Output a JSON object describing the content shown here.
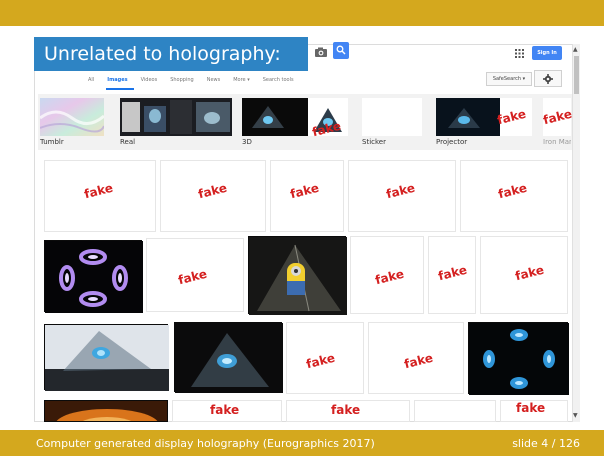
{
  "caption": "Unrelated to holography:",
  "footer": {
    "left": "Computer generated display holography (Eurographics 2017)",
    "right": "slide 4 / 126"
  },
  "header": {
    "sign_in": "Sign In"
  },
  "tabs": [
    "All",
    "Images",
    "Videos",
    "Shopping",
    "News",
    "More ▾",
    "Search tools"
  ],
  "active_tab": "Images",
  "safesearch": "SafeSearch ▾",
  "related": [
    {
      "label": "Tumblr"
    },
    {
      "label": "Real"
    },
    {
      "label": "3D"
    },
    {
      "label": "Sticker"
    },
    {
      "label": "Projector"
    },
    {
      "label": "Iron Man"
    }
  ],
  "fake_label": "fake",
  "colors": {
    "band": "#d4a81e",
    "caption_bg": "#2e84c4",
    "fake": "#d42020",
    "accent": "#4285f4"
  },
  "icons": [
    "camera-icon",
    "search-icon",
    "apps-grid-icon",
    "gear-icon"
  ]
}
